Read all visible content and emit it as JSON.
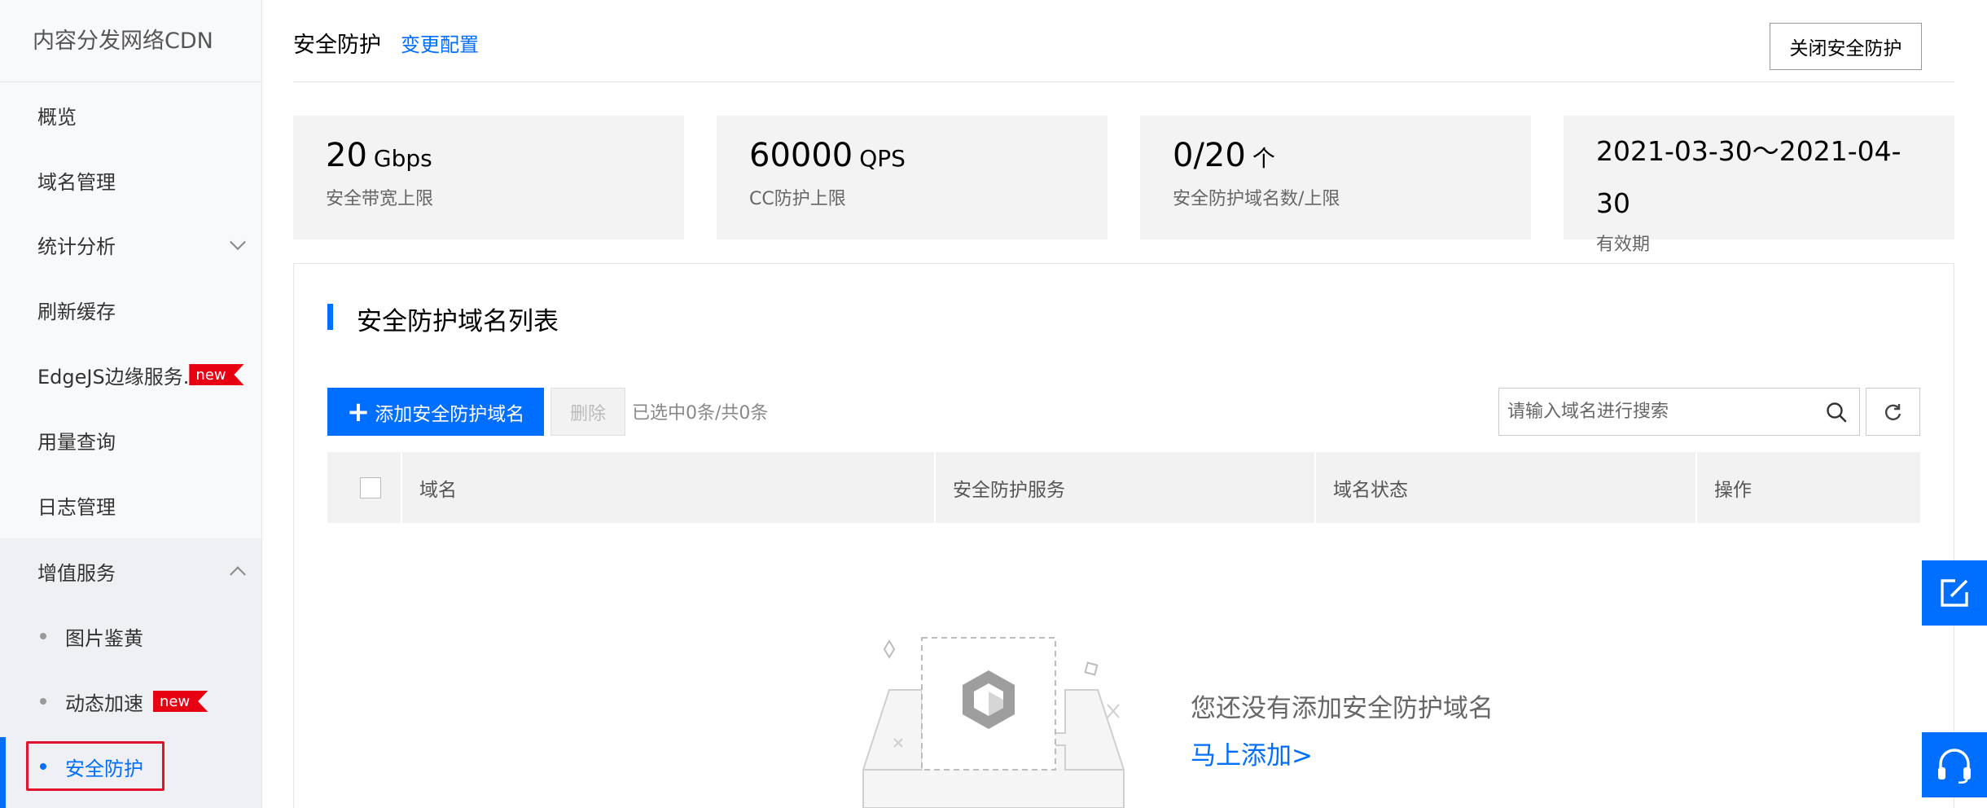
{
  "sidebar": {
    "title": "内容分发网络CDN",
    "items": [
      {
        "label": "概览"
      },
      {
        "label": "域名管理"
      },
      {
        "label": "统计分析"
      },
      {
        "label": "刷新缓存"
      },
      {
        "label": "EdgeJS边缘服务.",
        "badge": "new"
      },
      {
        "label": "用量查询"
      },
      {
        "label": "日志管理"
      },
      {
        "label": "增值服务"
      }
    ],
    "sub_items": [
      {
        "label": "图片鉴黄"
      },
      {
        "label": "动态加速",
        "badge": "new"
      },
      {
        "label": "安全防护"
      }
    ]
  },
  "header": {
    "title": "安全防护",
    "change_link": "变更配置",
    "close_button": "关闭安全防护"
  },
  "stats": [
    {
      "value": "20",
      "unit": "Gbps",
      "label": "安全带宽上限"
    },
    {
      "value": "60000",
      "unit": "QPS",
      "label": "CC防护上限"
    },
    {
      "value": "0/20",
      "unit": "个",
      "label": "安全防护域名数/上限"
    },
    {
      "value_line1": "2021-03-30～2021-04-",
      "value_line2": "30",
      "label": "有效期"
    }
  ],
  "section": {
    "title": "安全防护域名列表",
    "add_button": "添加安全防护域名",
    "delete_button": "删除",
    "selection_text": "已选中0条/共0条",
    "search_placeholder": "请输入域名进行搜索"
  },
  "table": {
    "columns": [
      "域名",
      "安全防护服务",
      "域名状态",
      "操作"
    ]
  },
  "empty": {
    "message": "您还没有添加安全防护域名",
    "link": "马上添加>"
  },
  "colors": {
    "accent": "#006eff",
    "badge": "#e60012",
    "highlight_outline": "#e0142e"
  },
  "icons": [
    "chevron-down-icon",
    "chevron-up-icon",
    "plus-icon",
    "search-icon",
    "refresh-icon",
    "edit-icon",
    "headset-icon",
    "empty-box-illustration"
  ]
}
